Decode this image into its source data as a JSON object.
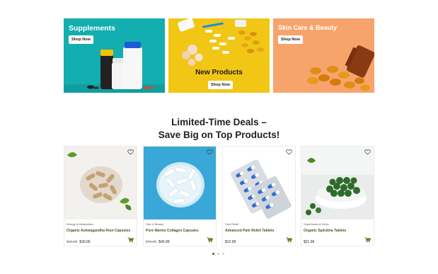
{
  "banners": [
    {
      "title": "Supplements",
      "cta": "Shop Now",
      "bg": "#13aeb0"
    },
    {
      "title": "New Products",
      "cta": "Shop Now",
      "bg": "#f2c615"
    },
    {
      "title": "Skin Care & Beauty",
      "cta": "Shop Now",
      "bg": "#f7a46c"
    }
  ],
  "deals": {
    "title_line1": "Limited-Time Deals –",
    "title_line2": "Save Big on Top Products!"
  },
  "products": [
    {
      "category": "Energy & Metabolism",
      "name": "Organic Ashwagandha Root Capsules",
      "old_price": "$32.00",
      "price": "$30.00"
    },
    {
      "category": "Skin & Beauty",
      "name": "Pure Marine Collagen Capsules",
      "old_price": "$49.00",
      "price": "$45.99"
    },
    {
      "category": "Pain Relief",
      "name": "Advanced Pain Relief Tablets",
      "old_price": "",
      "price": "$12.99"
    },
    {
      "category": "Superfoods & Detox",
      "name": "Organic Spirulina Tablets",
      "old_price": "",
      "price": "$21.99"
    }
  ],
  "colors": {
    "accent_green": "#3d5a1e",
    "cart_green": "#5a7d1a"
  },
  "carousel": {
    "pages": 3,
    "active": 1
  }
}
